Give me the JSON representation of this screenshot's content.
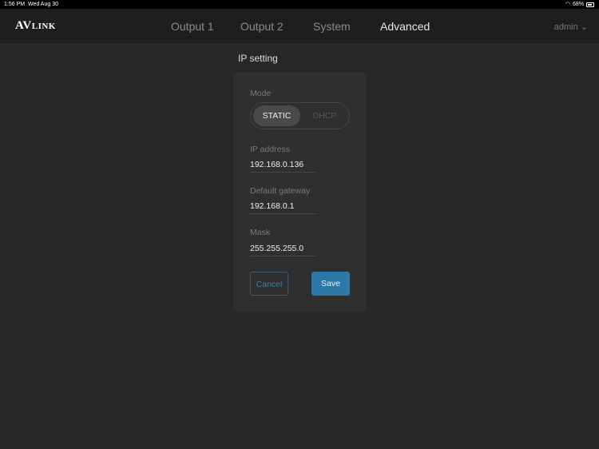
{
  "status_bar": {
    "time": "1:56 PM",
    "date": "Wed Aug 30",
    "battery": "68%"
  },
  "header": {
    "logo": "AVLINK",
    "tabs": [
      {
        "label": "Output 1"
      },
      {
        "label": "Output 2"
      },
      {
        "label": "System"
      },
      {
        "label": "Advanced",
        "active": true
      }
    ],
    "user": "admin"
  },
  "page_title": "IP setting",
  "form": {
    "mode_label": "Mode",
    "mode_options": [
      "STATIC",
      "DHCP"
    ],
    "mode_selected": "STATIC",
    "ip_label": "IP address",
    "ip_value": "192.168.0.136",
    "gateway_label": "Default gateway",
    "gateway_value": "192.168.0.1",
    "mask_label": "Mask",
    "mask_value": "255.255.255.0",
    "cancel": "Cancel",
    "save": "Save"
  }
}
